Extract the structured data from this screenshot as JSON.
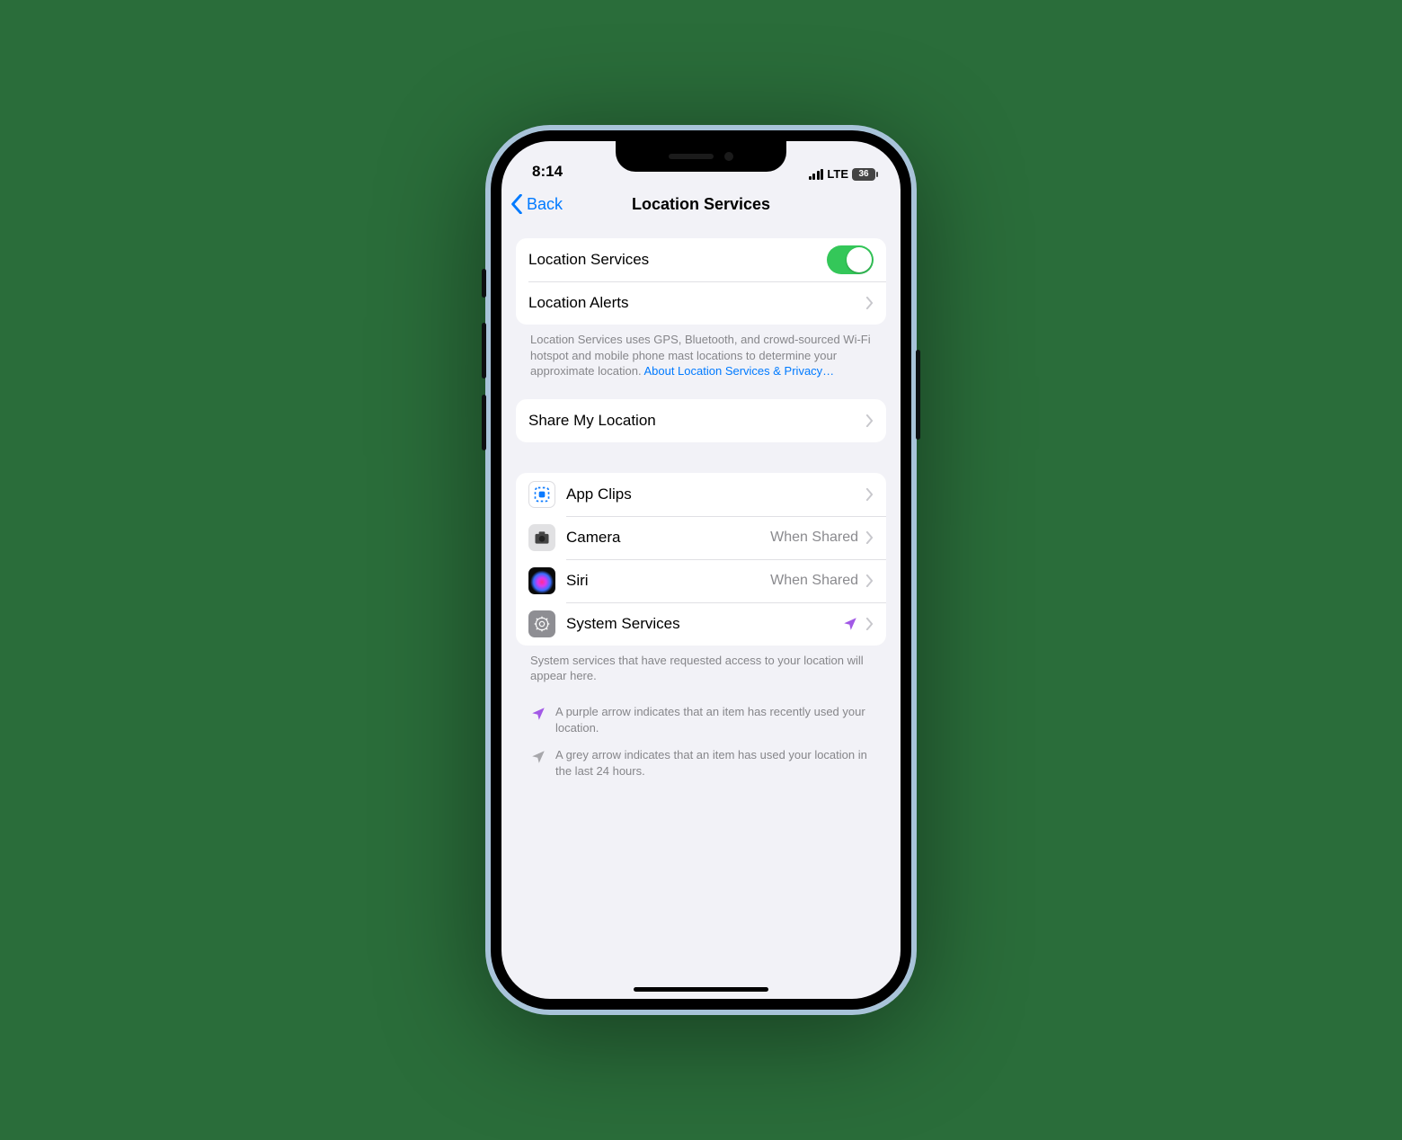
{
  "statusBar": {
    "time": "8:14",
    "carrier": "LTE",
    "batteryText": "36"
  },
  "nav": {
    "back": "Back",
    "title": "Location Services"
  },
  "group1": {
    "locationServicesLabel": "Location Services",
    "locationAlertsLabel": "Location Alerts"
  },
  "footer1": {
    "text": "Location Services uses GPS, Bluetooth, and crowd-sourced Wi-Fi hotspot and mobile phone mast locations to determine your approximate location. ",
    "link": "About Location Services & Privacy…"
  },
  "group2": {
    "shareMyLocationLabel": "Share My Location"
  },
  "apps": [
    {
      "name": "App Clips",
      "detail": "",
      "iconClass": "icon-appclips",
      "indicator": ""
    },
    {
      "name": "Camera",
      "detail": "When Shared",
      "iconClass": "icon-camera",
      "indicator": ""
    },
    {
      "name": "Siri",
      "detail": "When Shared",
      "iconClass": "icon-siri",
      "indicator": ""
    },
    {
      "name": "System Services",
      "detail": "",
      "iconClass": "icon-system",
      "indicator": "purple"
    }
  ],
  "footer2": {
    "text": "System services that have requested access to your location will appear here."
  },
  "legend": {
    "purple": "A purple arrow indicates that an item has recently used your location.",
    "grey": "A grey arrow indicates that an item has used your location in the last 24 hours."
  }
}
